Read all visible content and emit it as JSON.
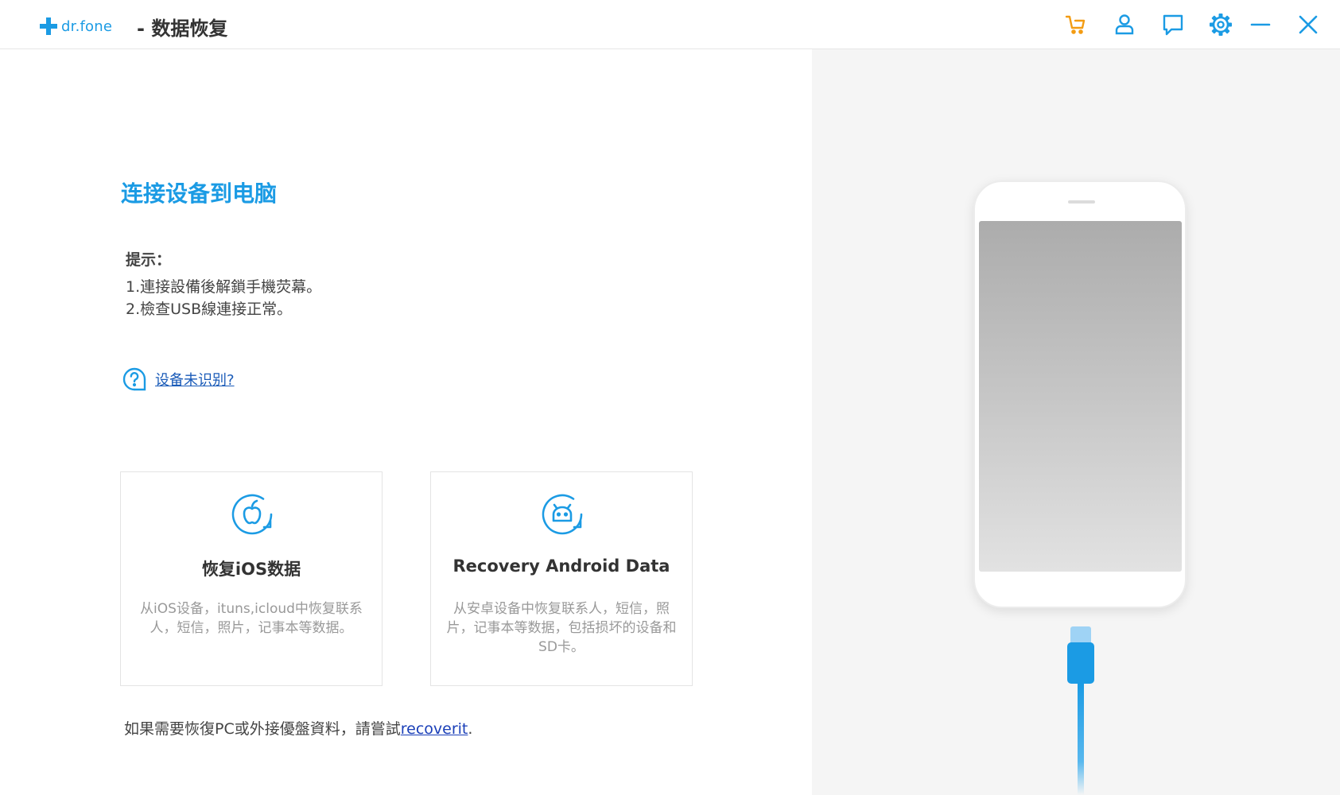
{
  "titlebar": {
    "logo_text": "dr.fone",
    "app_title": "- 数据恢复",
    "icons": [
      "cart-icon",
      "user-icon",
      "feedback-icon",
      "settings-icon",
      "minimize-icon",
      "close-icon"
    ]
  },
  "main": {
    "title": "连接设备到电脑",
    "tips_label": "提示：",
    "tips": [
      "1.連接設備後解鎖手機荧幕。",
      "2.檢查USB線連接正常。"
    ],
    "help_link": "设备未识别?"
  },
  "cards": [
    {
      "id": "ios",
      "title": "恢复iOS数据",
      "description": "从iOS设备，ituns,icloud中恢复联系人，短信，照片，记事本等数据。",
      "icon": "apple-restore-icon"
    },
    {
      "id": "android",
      "title": "Recovery Android Data",
      "description": "从安卓设备中恢复联系人，短信，照片，记事本等数据，包括损坏的设备和SD卡。",
      "icon": "android-restore-icon"
    }
  ],
  "footer": {
    "text": "如果需要恢復PC或外接優盤資料，請嘗試",
    "link": "recoverit",
    "suffix": "."
  },
  "colors": {
    "accent": "#1b9be4",
    "cart": "#f39c12",
    "link": "#1a3fb8",
    "panel_bg": "#f5f5f5"
  }
}
